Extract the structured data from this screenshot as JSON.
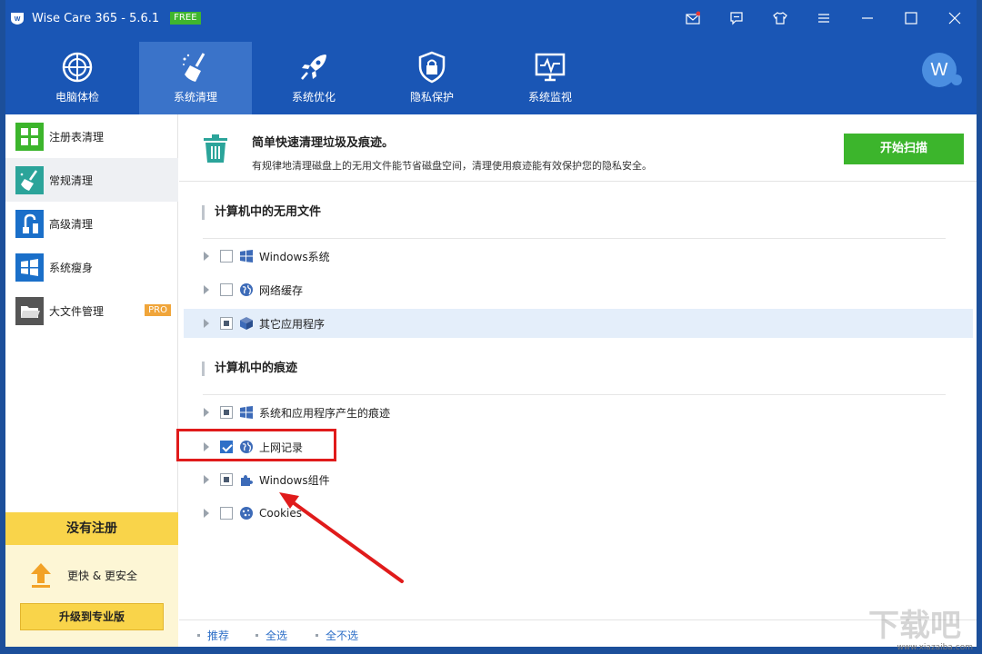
{
  "window": {
    "title": "Wise Care 365 - 5.6.1",
    "badge": "FREE"
  },
  "titlebar_icons": [
    "mail-icon",
    "chat-icon",
    "shirt-icon",
    "menu-icon",
    "minimize-icon",
    "maximize-icon",
    "close-icon"
  ],
  "topnav": {
    "items": [
      {
        "label": "电脑体检",
        "icon": "checkup-icon"
      },
      {
        "label": "系统清理",
        "icon": "broom-icon"
      },
      {
        "label": "系统优化",
        "icon": "rocket-icon"
      },
      {
        "label": "隐私保护",
        "icon": "lock-icon"
      },
      {
        "label": "系统监视",
        "icon": "monitor-icon"
      }
    ],
    "active": "系统清理",
    "avatar_letter": "W"
  },
  "sidebar": {
    "items": [
      {
        "label": "注册表清理",
        "icon": "registry-icon",
        "color": "#3cb52c"
      },
      {
        "label": "常规清理",
        "icon": "clean-icon",
        "color": "#2ba49a"
      },
      {
        "label": "高级清理",
        "icon": "vacuum-icon",
        "color": "#1a6fc9"
      },
      {
        "label": "系统瘦身",
        "icon": "windows-icon",
        "color": "#1a6fc9"
      },
      {
        "label": "大文件管理",
        "icon": "folder-icon",
        "color": "#555555"
      }
    ],
    "pro_badge": "PRO",
    "register": {
      "title": "没有注册",
      "tagline": "更快 & 更安全",
      "upgrade_label": "升级到专业版"
    }
  },
  "main": {
    "info": {
      "title": "简单快速清理垃圾及痕迹。",
      "subtitle": "有规律地清理磁盘上的无用文件能节省磁盘空间，清理使用痕迹能有效保护您的隐私安全。",
      "scan_label": "开始扫描"
    },
    "sections": [
      {
        "title": "计算机中的无用文件",
        "items": [
          {
            "label": "Windows系统",
            "state": "unchecked"
          },
          {
            "label": "网络缓存",
            "state": "unchecked"
          },
          {
            "label": "其它应用程序",
            "state": "partial"
          }
        ]
      },
      {
        "title": "计算机中的痕迹",
        "items": [
          {
            "label": "系统和应用程序产生的痕迹",
            "state": "partial"
          },
          {
            "label": "上网记录",
            "state": "checked"
          },
          {
            "label": "Windows组件",
            "state": "partial"
          },
          {
            "label": "Cookies",
            "state": "unchecked"
          }
        ]
      }
    ],
    "footer": {
      "recommend": "推荐",
      "select_all": "全选",
      "select_none": "全不选"
    }
  },
  "watermark": "www.xiazaiba.com",
  "colors": {
    "brand_blue": "#1a56b5",
    "active_nav": "#3a73c9",
    "scan_green": "#3cb52c",
    "register_yellow": "#f9d44a",
    "highlight_red": "#e01b1b"
  }
}
